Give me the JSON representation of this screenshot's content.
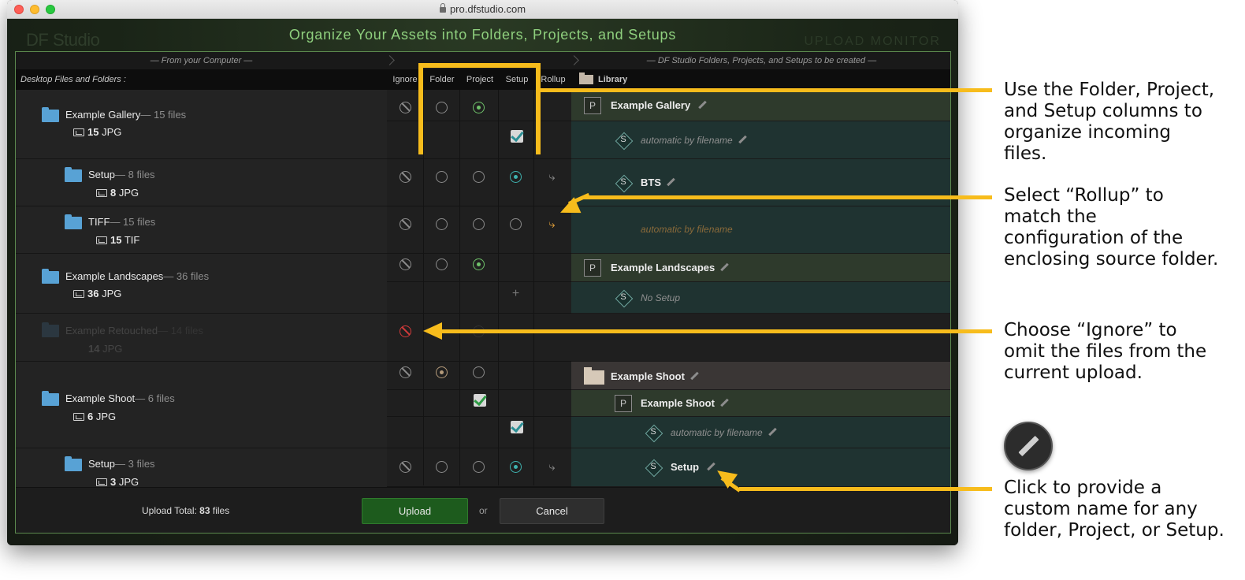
{
  "browser": {
    "url": "pro.dfstudio.com"
  },
  "app": {
    "brand": "DF Studio",
    "heading": "Organize Your Assets into Folders, Projects, and Setups",
    "monitor": "UPLOAD MONITOR"
  },
  "panel": {
    "left_header": "— From your Computer —",
    "right_header": "— DF Studio Folders, Projects, and Setups to be created —",
    "left_subheader": "Desktop Files and Folders :",
    "columns": [
      "Ignore",
      "Folder",
      "Project",
      "Setup",
      "Rollup"
    ],
    "library_label": "Library"
  },
  "left_rows": [
    {
      "name": "Example Gallery",
      "count": "— 15 files",
      "num": "15",
      "type": "JPG"
    },
    {
      "name": "Setup",
      "count": "— 8 files",
      "num": "8",
      "type": "JPG"
    },
    {
      "name": "TIFF",
      "count": "— 15 files",
      "num": "15",
      "type": "TIF"
    },
    {
      "name": "Example Landscapes",
      "count": "— 36 files",
      "num": "36",
      "type": "JPG"
    },
    {
      "name": "Example Retouched",
      "count": "— 14 files",
      "num": "14",
      "type": "JPG"
    },
    {
      "name": "Example Shoot",
      "count": "— 6 files",
      "num": "6",
      "type": "JPG"
    },
    {
      "name": "Setup",
      "count": "— 3 files",
      "num": "3",
      "type": "JPG"
    }
  ],
  "right_rows": {
    "gallery_project": "Example Gallery",
    "gallery_setup": "automatic by filename",
    "bts_setup": "BTS",
    "tiff_setup": "automatic by filename",
    "landscapes_project": "Example Landscapes",
    "landscapes_setup": "No Setup",
    "shoot_folder": "Example Shoot",
    "shoot_project": "Example Shoot",
    "shoot_setup_auto": "automatic by filename",
    "shoot_setup": "Setup",
    "p_letter": "P",
    "s_letter": "S"
  },
  "footer": {
    "total_prefix": "Upload Total:",
    "total_num": "83",
    "total_suffix": "files",
    "upload": "Upload",
    "or": "or",
    "cancel": "Cancel"
  },
  "annotations": {
    "a1": "Use the Folder, Project,\nand Setup columns to\norganize incoming\nfiles.",
    "a2": "Select “Rollup” to\nmatch the\nconfiguration of the\nenclosing source folder.",
    "a3": "Choose “Ignore” to\nomit the files from the\ncurrent upload.",
    "a4": "Click to provide a\ncustom name for any\nfolder, Project, or Setup."
  },
  "colors": {
    "accent": "#f7bc1c",
    "heading": "#8fd07e",
    "upload": "#1d5b1d"
  }
}
